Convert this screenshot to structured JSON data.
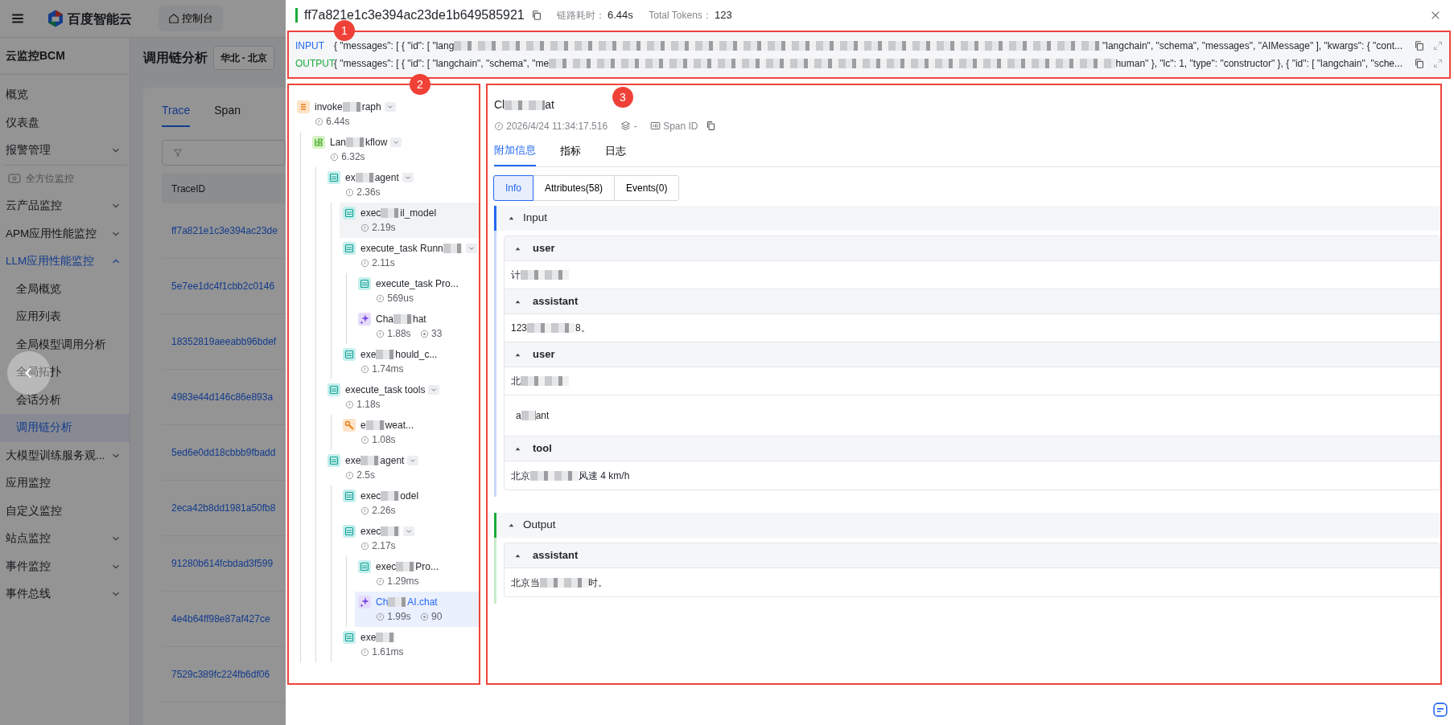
{
  "app": {
    "logo_text": "百度智能云",
    "console_button": "控制台",
    "product_title": "云监控BCM",
    "page_title": "调用链分析",
    "region": "华北 - 北京",
    "sidebar": [
      {
        "kind": "item",
        "label": "概览"
      },
      {
        "kind": "item",
        "label": "仪表盘"
      },
      {
        "kind": "item",
        "label": "报警管理",
        "expanded": false
      },
      {
        "kind": "section",
        "label": "全方位监控"
      },
      {
        "kind": "item",
        "label": "云产品监控",
        "expanded": false
      },
      {
        "kind": "item",
        "label": "APM应用性能监控",
        "expanded": false
      },
      {
        "kind": "item",
        "label": "LLM应用性能监控",
        "expanded": true,
        "children": [
          {
            "label": "全局概览",
            "selected": false
          },
          {
            "label": "应用列表",
            "selected": false
          },
          {
            "label": "全局模型调用分析",
            "selected": false
          },
          {
            "label": "全局拓扑",
            "selected": false
          },
          {
            "label": "会话分析",
            "selected": false
          },
          {
            "label": "调用链分析",
            "selected": true
          }
        ]
      },
      {
        "kind": "item",
        "label": "大模型训练服务观...",
        "expanded": false
      },
      {
        "kind": "item",
        "label": "应用监控"
      },
      {
        "kind": "item",
        "label": "自定义监控"
      },
      {
        "kind": "item",
        "label": "站点监控",
        "expanded": false
      },
      {
        "kind": "item",
        "label": "事件监控",
        "expanded": false
      },
      {
        "kind": "item",
        "label": "事件总线",
        "expanded": false
      }
    ],
    "tabs": [
      {
        "label": "Trace",
        "selected": true
      },
      {
        "label": "Span",
        "selected": false
      }
    ],
    "table": {
      "columns": [
        "TraceID"
      ],
      "rows": [
        "ff7a821e1c3e394ac23de",
        "5e7ee1dc4f1cbb2c0146",
        "18352819aeeabb96bdef",
        "4983e44d146c86e893a",
        "5ed6e0dd18cbbb9fbadd",
        "2eca42b8dd1981a50fb8",
        "91280b614fcbdad3f599",
        "4e4b64ff98e87af427ce",
        "7529c389fc224fb6df06"
      ]
    }
  },
  "drawer": {
    "trace_id": "ff7a821e1c3e394ac23de1b649585921",
    "duration_label": "链路耗时：",
    "duration": "6.44s",
    "tokens_label": "Total Tokens：",
    "tokens": "123",
    "io": {
      "marker": "1",
      "rows": [
        {
          "kind": "input",
          "label": "INPUT",
          "parts": [
            "{ \"messages\": [ { \"id\": [ \"lang",
            "\"langchain\", \"schema\", \"messages\", \"AIMessage\" ], \"kwargs\": { \"cont..."
          ]
        },
        {
          "kind": "output",
          "label": "OUTPUT",
          "parts": [
            "{ \"messages\": [ { \"id\": [ \"langchain\", \"schema\", \"me",
            "human\" }, \"lc\": 1, \"type\": \"constructor\" }, { \"id\": [ \"langchain\", \"sche..."
          ]
        }
      ]
    },
    "tree": {
      "marker": "2",
      "nodes": [
        {
          "kind": "graph",
          "name": [
            "invoke",
            "raph"
          ],
          "duration": "6.44s",
          "collapsible": true,
          "selected": false,
          "hovered": false,
          "children": [
            {
              "kind": "flow",
              "name": [
                "Lan",
                "kflow"
              ],
              "duration": "6.32s",
              "collapsible": true,
              "selected": false,
              "hovered": false,
              "children": [
                {
                  "kind": "task",
                  "name": [
                    "ex",
                    "agent"
                  ],
                  "duration": "2.36s",
                  "collapsible": true,
                  "selected": false,
                  "hovered": false,
                  "children": [
                    {
                      "kind": "task",
                      "name": [
                        "exec",
                        "il_model"
                      ],
                      "duration": "2.19s",
                      "collapsible": false,
                      "selected": false,
                      "hovered": true
                    },
                    {
                      "kind": "task",
                      "name": [
                        "execute_task Runn"
                      ],
                      "masked_tail": true,
                      "duration": "2.11s",
                      "collapsible": true,
                      "selected": false,
                      "hovered": false,
                      "children": [
                        {
                          "kind": "task",
                          "name": [
                            "execute_task Pro..."
                          ],
                          "duration": "569us",
                          "collapsible": false,
                          "selected": false,
                          "hovered": false
                        },
                        {
                          "kind": "llm",
                          "name": [
                            "Cha",
                            "hat"
                          ],
                          "duration": "1.88s",
                          "tokens": "33",
                          "collapsible": false,
                          "selected": false,
                          "hovered": false
                        }
                      ]
                    },
                    {
                      "kind": "task",
                      "name": [
                        "exe",
                        "hould_c..."
                      ],
                      "duration": "1.74ms",
                      "collapsible": false,
                      "selected": false,
                      "hovered": false
                    }
                  ]
                },
                {
                  "kind": "task",
                  "name": [
                    "execute_task tools"
                  ],
                  "duration": "1.18s",
                  "collapsible": true,
                  "selected": false,
                  "hovered": false,
                  "children": [
                    {
                      "kind": "tool",
                      "name": [
                        "e",
                        "weat..."
                      ],
                      "duration": "1.08s",
                      "collapsible": false,
                      "selected": false,
                      "hovered": false
                    }
                  ]
                },
                {
                  "kind": "task",
                  "name": [
                    "exe",
                    "agent"
                  ],
                  "duration": "2.5s",
                  "collapsible": true,
                  "selected": false,
                  "hovered": false,
                  "children": [
                    {
                      "kind": "task",
                      "name": [
                        "exec",
                        "odel"
                      ],
                      "duration": "2.26s",
                      "collapsible": false,
                      "selected": false,
                      "hovered": false
                    },
                    {
                      "kind": "task",
                      "name": [
                        "exec"
                      ],
                      "masked_tail": true,
                      "duration": "2.17s",
                      "collapsible": true,
                      "selected": false,
                      "hovered": false,
                      "children": [
                        {
                          "kind": "task",
                          "name": [
                            "exec",
                            "Pro..."
                          ],
                          "duration": "1.29ms",
                          "collapsible": false,
                          "selected": false,
                          "hovered": false
                        },
                        {
                          "kind": "llm",
                          "name": [
                            "Ch",
                            "AI.chat"
                          ],
                          "duration": "1.99s",
                          "tokens": "90",
                          "collapsible": false,
                          "selected": true,
                          "hovered": false
                        }
                      ]
                    },
                    {
                      "kind": "task",
                      "name": [
                        "exe"
                      ],
                      "masked_tail": true,
                      "duration": "1.61ms",
                      "collapsible": false,
                      "selected": false,
                      "hovered": false
                    }
                  ]
                }
              ]
            }
          ]
        }
      ]
    },
    "detail": {
      "marker": "3",
      "title": [
        "Cl",
        "at"
      ],
      "time": "2026/4/24 11:34:17.516",
      "layer": "-",
      "span_id": "Span ID",
      "tabs": [
        {
          "label": "附加信息",
          "selected": true
        },
        {
          "label": "指标",
          "selected": false
        },
        {
          "label": "日志",
          "selected": false
        }
      ],
      "segments": [
        {
          "label": "Info",
          "selected": true
        },
        {
          "label": "Attributes(58)",
          "selected": false
        },
        {
          "label": "Events(0)",
          "selected": false
        }
      ],
      "sections": [
        {
          "kind": "input",
          "title": "Input",
          "messages": [
            {
              "kind": "message",
              "role": "user",
              "content": [
                "计"
              ],
              "masked_tail": true
            },
            {
              "kind": "message",
              "role": "assistant",
              "content": [
                "123",
                "8。"
              ]
            },
            {
              "kind": "message",
              "role": "user",
              "content": [
                "北"
              ],
              "masked_tail": true
            },
            {
              "kind": "plain",
              "content": [
                "a",
                "ant"
              ]
            },
            {
              "kind": "message",
              "role": "tool",
              "content": [
                "北京 ",
                "风速 4 km/h"
              ]
            }
          ]
        },
        {
          "kind": "output",
          "title": "Output",
          "messages": [
            {
              "kind": "message",
              "role": "assistant",
              "content": [
                "北京当",
                "时。"
              ]
            }
          ]
        }
      ]
    }
  }
}
